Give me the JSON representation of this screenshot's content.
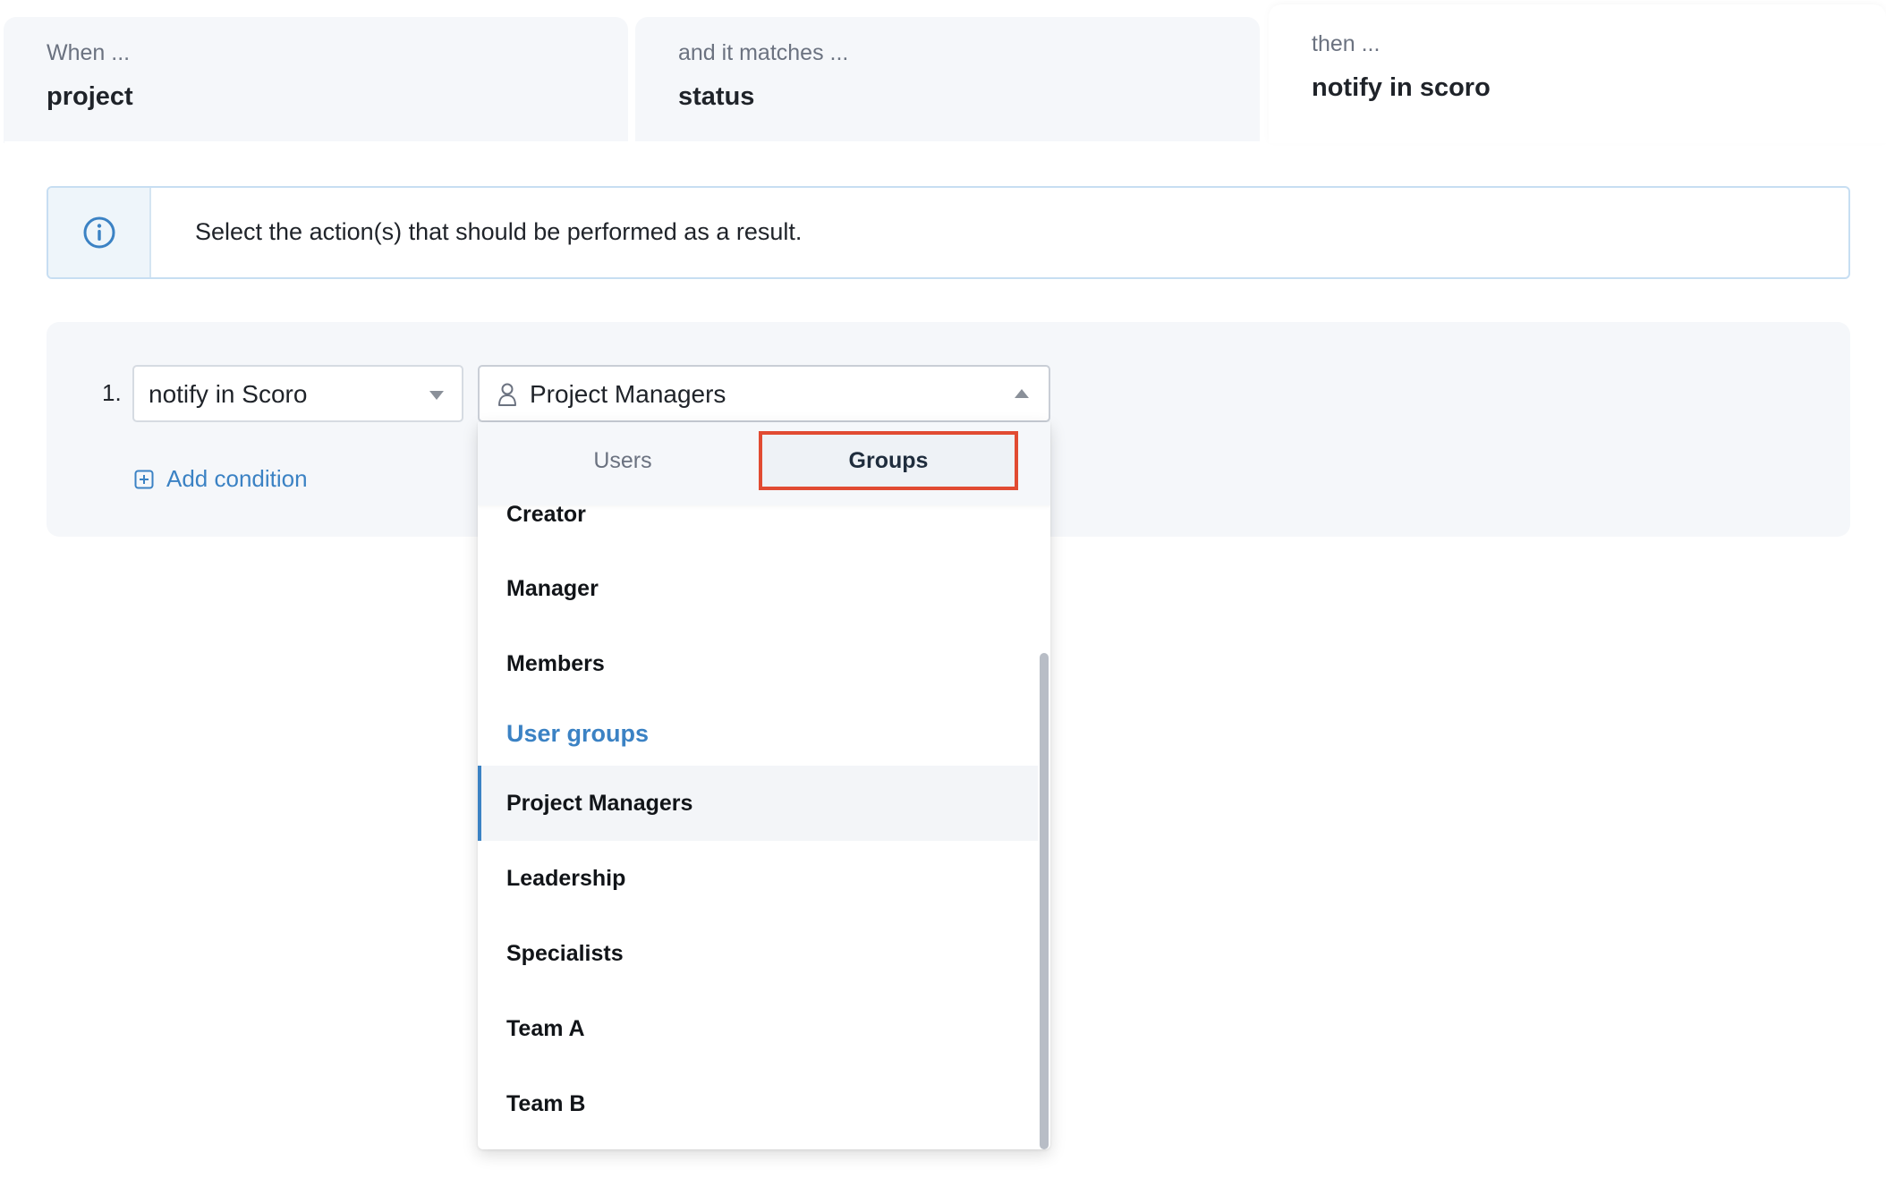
{
  "steps": [
    {
      "sub": "When ...",
      "main": "project"
    },
    {
      "sub": "and it matches ...",
      "main": "status"
    },
    {
      "sub": "then ...",
      "main": "notify in scoro"
    }
  ],
  "info": {
    "icon": "info-icon",
    "text": "Select the action(s) that should be performed as a result."
  },
  "action": {
    "number": "1.",
    "type_value": "notify in Scoro",
    "recipient_value": "Project Managers",
    "add_condition": "Add condition"
  },
  "dropdown": {
    "tabs": {
      "users": "Users",
      "groups": "Groups",
      "active": "Groups"
    },
    "items_top": [
      "Creator",
      "Manager",
      "Members"
    ],
    "section_header": "User groups",
    "groups": [
      "Project Managers",
      "Leadership",
      "Specialists",
      "Team A",
      "Team B"
    ],
    "selected": "Project Managers"
  },
  "colors": {
    "accent": "#3b82c4",
    "highlight_border": "#e14b32"
  }
}
